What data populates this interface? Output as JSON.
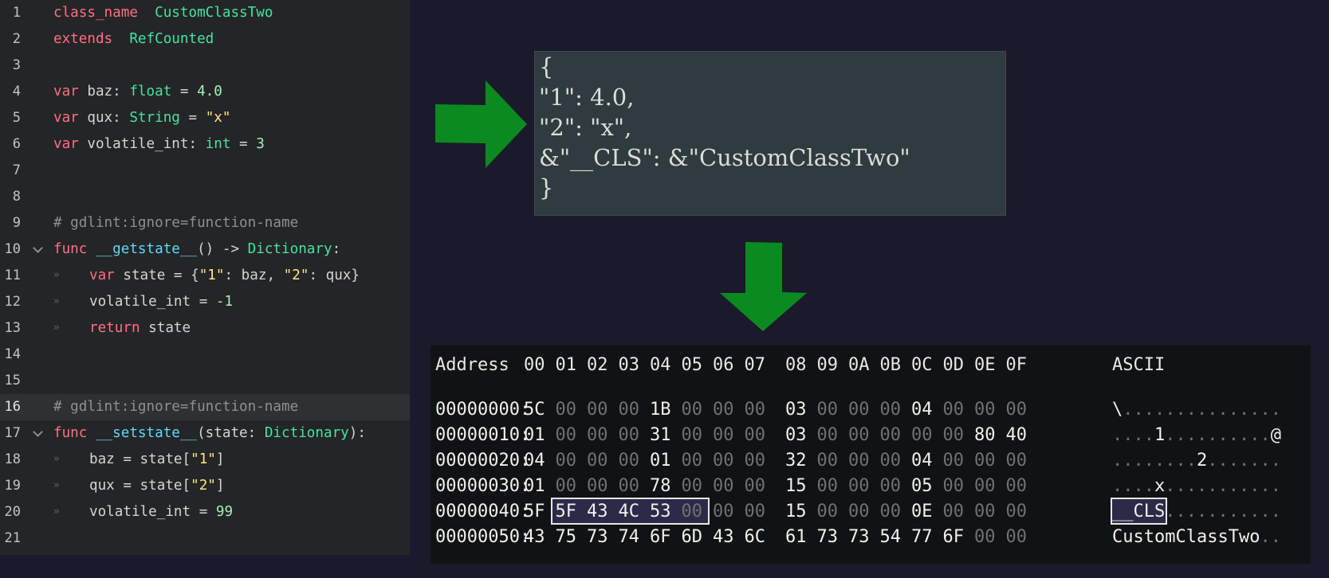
{
  "editor": {
    "lines": [
      {
        "n": "1",
        "parts": [
          [
            "kw",
            "class_name"
          ],
          [
            "",
            "  "
          ],
          [
            "ty",
            "CustomClassTwo"
          ]
        ]
      },
      {
        "n": "2",
        "parts": [
          [
            "kw",
            "extends"
          ],
          [
            "",
            "  "
          ],
          [
            "ty",
            "RefCounted"
          ]
        ]
      },
      {
        "n": "3",
        "parts": []
      },
      {
        "n": "4",
        "parts": [
          [
            "kw",
            "var"
          ],
          [
            "",
            " baz: "
          ],
          [
            "ty",
            "float"
          ],
          [
            "",
            " = "
          ],
          [
            "nu",
            "4.0"
          ]
        ]
      },
      {
        "n": "5",
        "parts": [
          [
            "kw",
            "var"
          ],
          [
            "",
            " qux: "
          ],
          [
            "ty",
            "String"
          ],
          [
            "",
            " = "
          ],
          [
            "st",
            "\"x\""
          ]
        ]
      },
      {
        "n": "6",
        "parts": [
          [
            "kw",
            "var"
          ],
          [
            "",
            " volatile_int: "
          ],
          [
            "ty",
            "int"
          ],
          [
            "",
            " = "
          ],
          [
            "nu",
            "3"
          ]
        ]
      },
      {
        "n": "7",
        "parts": []
      },
      {
        "n": "8",
        "parts": []
      },
      {
        "n": "9",
        "parts": [
          [
            "cm",
            "# gdlint:ignore=function-name"
          ]
        ]
      },
      {
        "n": "10",
        "fold": true,
        "parts": [
          [
            "kw",
            "func"
          ],
          [
            "",
            " "
          ],
          [
            "fn",
            "__getstate__"
          ],
          [
            "",
            "() -> "
          ],
          [
            "ty",
            "Dictionary"
          ],
          [
            "",
            ":"
          ]
        ]
      },
      {
        "n": "11",
        "indent": true,
        "parts": [
          [
            "kw",
            "var"
          ],
          [
            "",
            " state = {"
          ],
          [
            "st",
            "\"1\""
          ],
          [
            "",
            ": baz, "
          ],
          [
            "st",
            "\"2\""
          ],
          [
            "",
            ": qux}"
          ]
        ]
      },
      {
        "n": "12",
        "indent": true,
        "parts": [
          [
            "",
            "volatile_int = "
          ],
          [
            "nu",
            "-1"
          ]
        ]
      },
      {
        "n": "13",
        "indent": true,
        "parts": [
          [
            "kw",
            "return"
          ],
          [
            "",
            " state"
          ]
        ]
      },
      {
        "n": "14",
        "parts": []
      },
      {
        "n": "15",
        "parts": []
      },
      {
        "n": "16",
        "current": true,
        "parts": [
          [
            "cm",
            "# gdlint:ignore=function-name"
          ]
        ]
      },
      {
        "n": "17",
        "fold": true,
        "parts": [
          [
            "kw",
            "func"
          ],
          [
            "",
            " "
          ],
          [
            "fn",
            "__setstate__"
          ],
          [
            "",
            "(state: "
          ],
          [
            "ty",
            "Dictionary"
          ],
          [
            "",
            "):"
          ]
        ]
      },
      {
        "n": "18",
        "indent": true,
        "parts": [
          [
            "",
            "baz = state["
          ],
          [
            "st",
            "\"1\""
          ],
          [
            "",
            "]"
          ]
        ]
      },
      {
        "n": "19",
        "indent": true,
        "parts": [
          [
            "",
            "qux = state["
          ],
          [
            "st",
            "\"2\""
          ],
          [
            "",
            "]"
          ]
        ]
      },
      {
        "n": "20",
        "indent": true,
        "parts": [
          [
            "",
            "volatile_int = "
          ],
          [
            "nu",
            "99"
          ]
        ]
      },
      {
        "n": "21",
        "parts": []
      }
    ],
    "indent_glyph": "»"
  },
  "json_box": {
    "lines": [
      "{",
      "\"1\": 4.0,",
      "\"2\": \"x\",",
      "&\"__CLS\": &\"CustomClassTwo\"",
      "}"
    ]
  },
  "hex": {
    "header": {
      "address": "Address",
      "cols": [
        "00",
        "01",
        "02",
        "03",
        "04",
        "05",
        "06",
        "07",
        "08",
        "09",
        "0A",
        "0B",
        "0C",
        "0D",
        "0E",
        "0F"
      ],
      "ascii": "ASCII"
    },
    "rows": [
      {
        "addr": "00000000:",
        "bytes": [
          "5C",
          "00",
          "00",
          "00",
          "1B",
          "00",
          "00",
          "00",
          "03",
          "00",
          "00",
          "00",
          "04",
          "00",
          "00",
          "00"
        ],
        "ascii": "\\..............."
      },
      {
        "addr": "00000010:",
        "bytes": [
          "01",
          "00",
          "00",
          "00",
          "31",
          "00",
          "00",
          "00",
          "03",
          "00",
          "00",
          "00",
          "00",
          "00",
          "80",
          "40"
        ],
        "ascii": "....1..........@"
      },
      {
        "addr": "00000020:",
        "bytes": [
          "04",
          "00",
          "00",
          "00",
          "01",
          "00",
          "00",
          "00",
          "32",
          "00",
          "00",
          "00",
          "04",
          "00",
          "00",
          "00"
        ],
        "ascii": "........2......."
      },
      {
        "addr": "00000030:",
        "bytes": [
          "01",
          "00",
          "00",
          "00",
          "78",
          "00",
          "00",
          "00",
          "15",
          "00",
          "00",
          "00",
          "05",
          "00",
          "00",
          "00"
        ],
        "ascii": "....x..........."
      },
      {
        "addr": "00000040:",
        "bytes": [
          "5F",
          "5F",
          "43",
          "4C",
          "53",
          "00",
          "00",
          "00",
          "15",
          "00",
          "00",
          "00",
          "0E",
          "00",
          "00",
          "00"
        ],
        "ascii": "__CLS...........",
        "highlight": true
      },
      {
        "addr": "00000050:",
        "bytes": [
          "43",
          "75",
          "73",
          "74",
          "6F",
          "6D",
          "43",
          "6C",
          "61",
          "73",
          "73",
          "54",
          "77",
          "6F",
          "00",
          "00"
        ],
        "ascii": "CustomClassTwo.."
      }
    ]
  },
  "colors": {
    "arrow": "#0b8a1f",
    "editor_bg": "#242526",
    "json_bg": "#2f3b3e",
    "hex_bg": "#111213",
    "page_bg": "#1a1a2c"
  }
}
